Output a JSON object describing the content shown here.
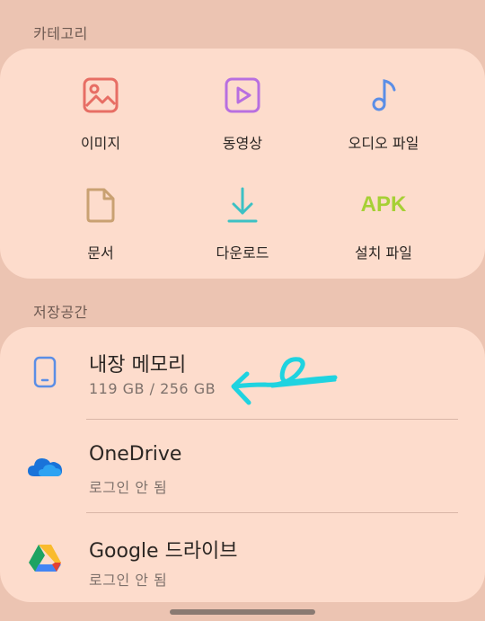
{
  "categories": {
    "header": "카테고리",
    "items": [
      {
        "label": "이미지",
        "icon": "image-icon"
      },
      {
        "label": "동영상",
        "icon": "video-icon"
      },
      {
        "label": "오디오 파일",
        "icon": "music-note-icon"
      },
      {
        "label": "문서",
        "icon": "document-icon"
      },
      {
        "label": "다운로드",
        "icon": "download-icon"
      },
      {
        "label": "설치 파일",
        "icon": "apk-icon",
        "badge": "APK"
      }
    ]
  },
  "storage": {
    "header": "저장공간",
    "items": [
      {
        "title": "내장 메모리",
        "subtitle": "119 GB / 256 GB",
        "icon": "phone-icon"
      },
      {
        "title": "OneDrive",
        "subtitle": "로그인 안 됨",
        "icon": "onedrive-cloud-icon"
      },
      {
        "title": "Google 드라이브",
        "subtitle": "로그인 안 됨",
        "icon": "google-drive-icon"
      }
    ]
  },
  "colors": {
    "background": "#ecc4b2",
    "card": "#fddccc",
    "image_icon": "#e76e64",
    "video_icon": "#b86fe0",
    "audio_icon": "#5b8ee6",
    "document_icon": "#c9a172",
    "download_icon": "#3cc1c4",
    "apk_icon": "#a6d035",
    "annotation_arrow": "#1fd3e0"
  }
}
